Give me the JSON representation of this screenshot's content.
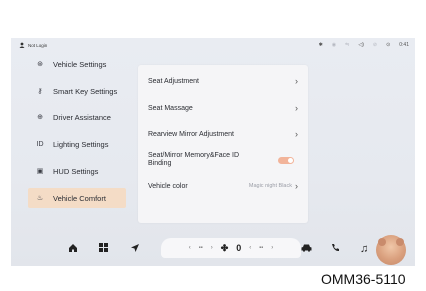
{
  "status": {
    "login": "Not Login",
    "time": "0:41",
    "icons": [
      "bluetooth-icon",
      "signal-icon",
      "network-icon",
      "volume-icon",
      "wifi-off-icon",
      "hotspot-icon"
    ]
  },
  "sidebar": {
    "items": [
      {
        "label": "Vehicle Settings",
        "icon": "car-settings-icon"
      },
      {
        "label": "Smart Key Settings",
        "icon": "key-icon"
      },
      {
        "label": "Driver Assistance",
        "icon": "steering-icon"
      },
      {
        "label": "Lighting Settings",
        "icon": "light-icon"
      },
      {
        "label": "HUD Settings",
        "icon": "hud-icon"
      },
      {
        "label": "Vehicle Comfort",
        "icon": "comfort-icon"
      }
    ],
    "active_index": 5
  },
  "panel": {
    "rows": [
      {
        "label": "Seat Adjustment"
      },
      {
        "label": "Seat Massage"
      },
      {
        "label": "Rearview Mirror Adjustment"
      },
      {
        "label": "Seat/Mirror Memory&Face ID Binding",
        "toggle": true
      },
      {
        "label": "Vehicle color",
        "value": "Magic night Black"
      }
    ]
  },
  "dock": {
    "climate_left": "--",
    "climate_right": "--",
    "fan_level": "0"
  },
  "caption": "OMM36-5110",
  "colors": {
    "accent": "#f2b49a",
    "active_bg": "#f4dcc6"
  }
}
